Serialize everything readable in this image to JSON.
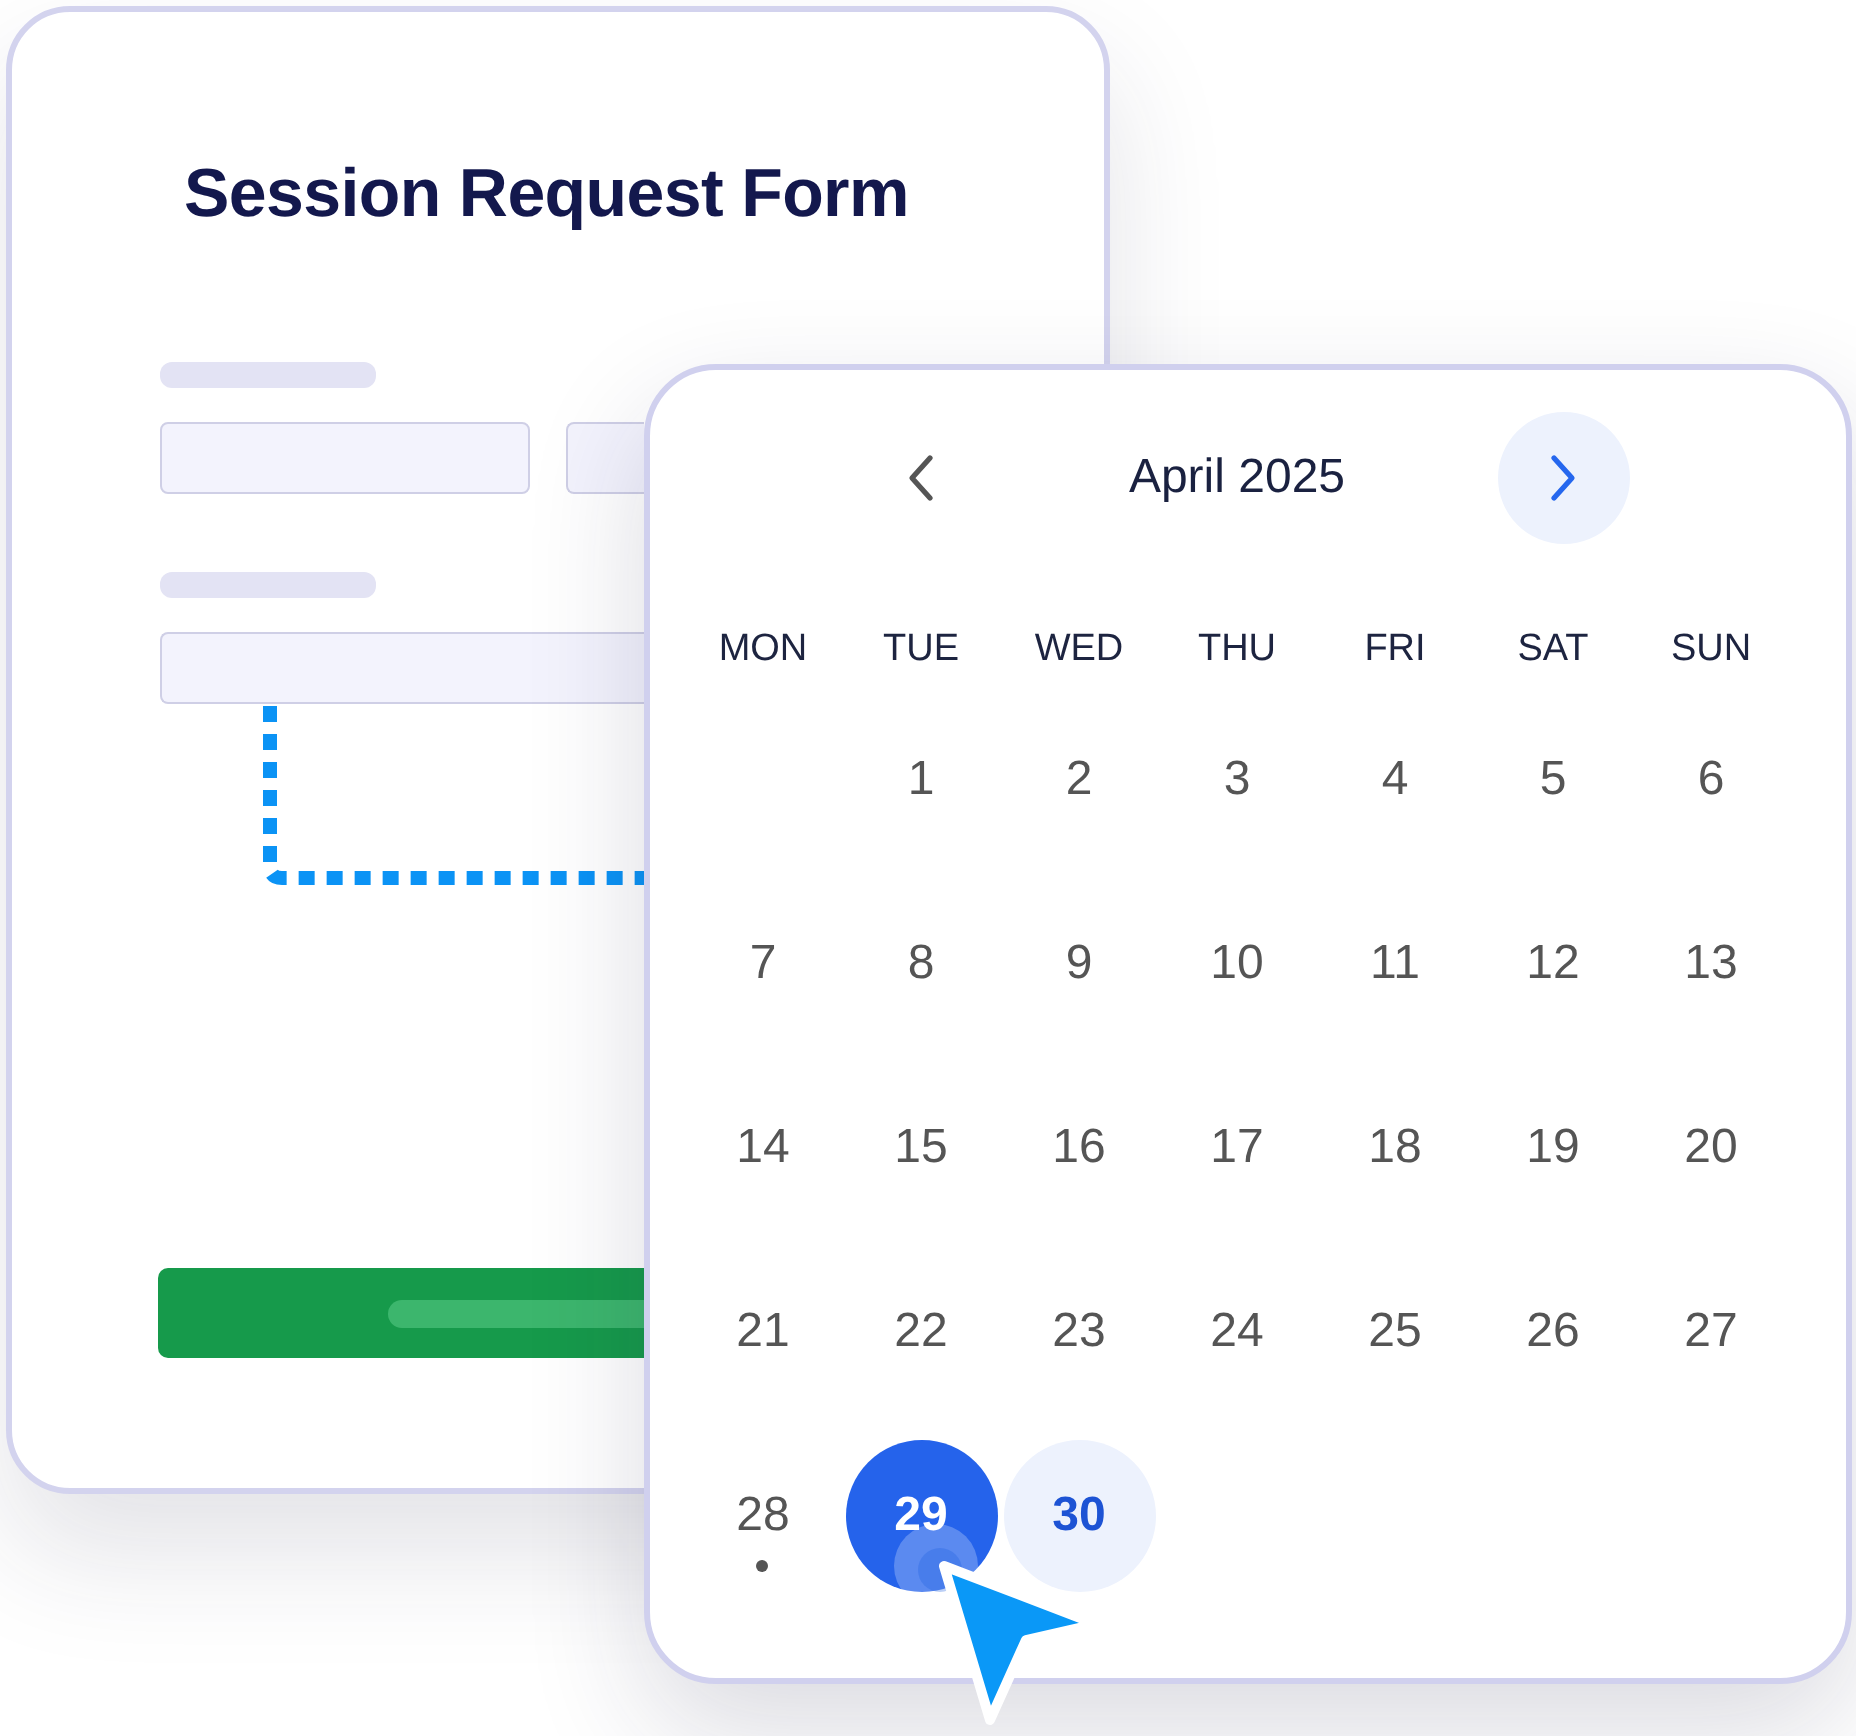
{
  "form": {
    "title": "Session Request Form",
    "groups": [
      {
        "fields": [
          {
            "kind": "input"
          },
          {
            "kind": "input"
          }
        ]
      },
      {
        "fields": [
          {
            "kind": "input"
          }
        ]
      }
    ],
    "button": {
      "kind": "submit"
    }
  },
  "calendar": {
    "month": "April 2025",
    "nav": [
      {
        "kind": "prev",
        "highlighted": false
      },
      {
        "kind": "next",
        "highlighted": true
      }
    ],
    "weekdays": [
      "MON",
      "TUE",
      "WED",
      "THU",
      "FRI",
      "SAT",
      "SUN"
    ],
    "weeks": [
      [
        {
          "kind": "blank"
        },
        {
          "kind": "day",
          "label": "1",
          "selected": false,
          "highlighted": false,
          "marked": false
        },
        {
          "kind": "day",
          "label": "2",
          "selected": false,
          "highlighted": false,
          "marked": false
        },
        {
          "kind": "day",
          "label": "3",
          "selected": false,
          "highlighted": false,
          "marked": false
        },
        {
          "kind": "day",
          "label": "4",
          "selected": false,
          "highlighted": false,
          "marked": false
        },
        {
          "kind": "day",
          "label": "5",
          "selected": false,
          "highlighted": false,
          "marked": false
        },
        {
          "kind": "day",
          "label": "6",
          "selected": false,
          "highlighted": false,
          "marked": false
        }
      ],
      [
        {
          "kind": "day",
          "label": "7",
          "selected": false,
          "highlighted": false,
          "marked": false
        },
        {
          "kind": "day",
          "label": "8",
          "selected": false,
          "highlighted": false,
          "marked": false
        },
        {
          "kind": "day",
          "label": "9",
          "selected": false,
          "highlighted": false,
          "marked": false
        },
        {
          "kind": "day",
          "label": "10",
          "selected": false,
          "highlighted": false,
          "marked": false
        },
        {
          "kind": "day",
          "label": "11",
          "selected": false,
          "highlighted": false,
          "marked": false
        },
        {
          "kind": "day",
          "label": "12",
          "selected": false,
          "highlighted": false,
          "marked": false
        },
        {
          "kind": "day",
          "label": "13",
          "selected": false,
          "highlighted": false,
          "marked": false
        }
      ],
      [
        {
          "kind": "day",
          "label": "14",
          "selected": false,
          "highlighted": false,
          "marked": false
        },
        {
          "kind": "day",
          "label": "15",
          "selected": false,
          "highlighted": false,
          "marked": false
        },
        {
          "kind": "day",
          "label": "16",
          "selected": false,
          "highlighted": false,
          "marked": false
        },
        {
          "kind": "day",
          "label": "17",
          "selected": false,
          "highlighted": false,
          "marked": false
        },
        {
          "kind": "day",
          "label": "18",
          "selected": false,
          "highlighted": false,
          "marked": false
        },
        {
          "kind": "day",
          "label": "19",
          "selected": false,
          "highlighted": false,
          "marked": false
        },
        {
          "kind": "day",
          "label": "20",
          "selected": false,
          "highlighted": false,
          "marked": false
        }
      ],
      [
        {
          "kind": "day",
          "label": "21",
          "selected": false,
          "highlighted": false,
          "marked": false
        },
        {
          "kind": "day",
          "label": "22",
          "selected": false,
          "highlighted": false,
          "marked": false
        },
        {
          "kind": "day",
          "label": "23",
          "selected": false,
          "highlighted": false,
          "marked": false
        },
        {
          "kind": "day",
          "label": "24",
          "selected": false,
          "highlighted": false,
          "marked": false
        },
        {
          "kind": "day",
          "label": "25",
          "selected": false,
          "highlighted": false,
          "marked": false
        },
        {
          "kind": "day",
          "label": "26",
          "selected": false,
          "highlighted": false,
          "marked": false
        },
        {
          "kind": "day",
          "label": "27",
          "selected": false,
          "highlighted": false,
          "marked": false
        }
      ],
      [
        {
          "kind": "day",
          "label": "28",
          "selected": false,
          "highlighted": false,
          "marked": true
        },
        {
          "kind": "day",
          "label": "29",
          "selected": true,
          "highlighted": false,
          "marked": false
        },
        {
          "kind": "day",
          "label": "30",
          "selected": false,
          "highlighted": true,
          "marked": false
        }
      ]
    ]
  }
}
